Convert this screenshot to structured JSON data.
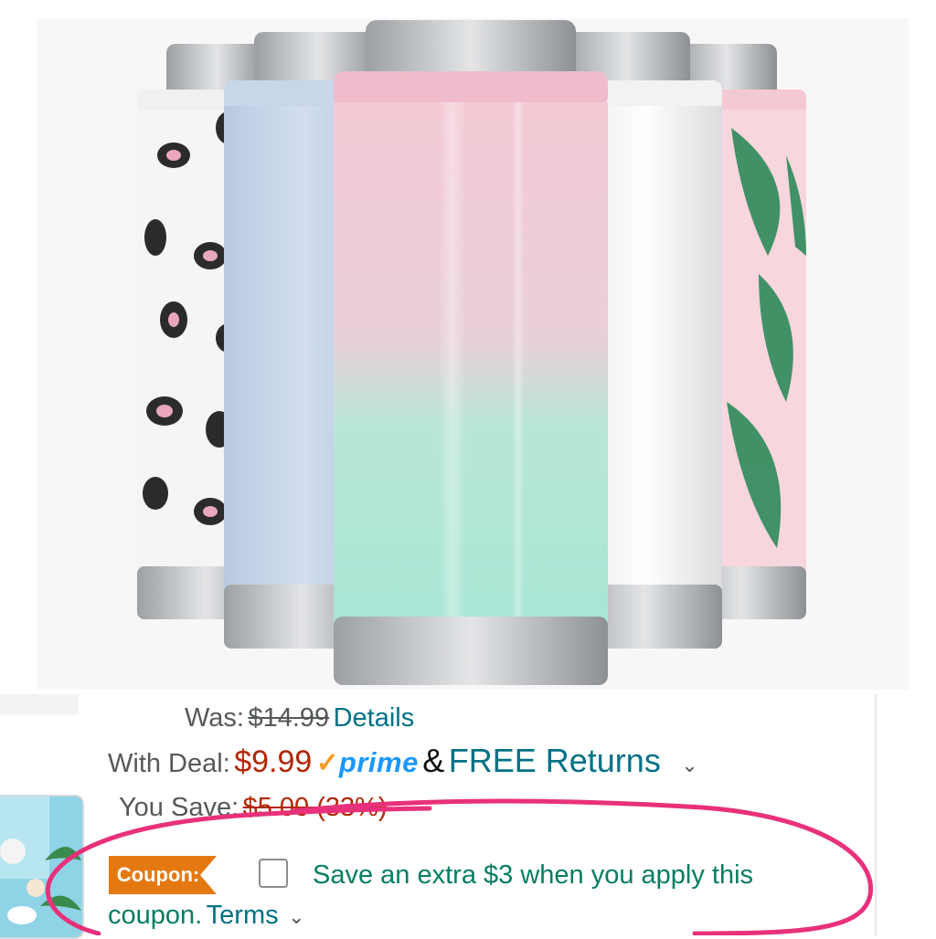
{
  "colors": {
    "price_red": "#b12704",
    "link_teal": "#007185",
    "coupon_green": "#067d62",
    "coupon_badge_orange": "#e47911",
    "prime_blue": "#1a98ff",
    "annotation_pink": "#e8317a"
  },
  "product_image": {
    "alt": "Five slim can cooler tumblers: leopard print, light blue, pink-to-mint iridescent glitter, white, and pink tropical leaf"
  },
  "pricing": {
    "was_label": "Was:",
    "was_price": "$14.99",
    "details_link": "Details",
    "deal_label": "With Deal:",
    "deal_price": "$9.99",
    "prime_check": "✓",
    "prime_text": "prime",
    "ampersand": "&",
    "free_returns": "FREE Returns",
    "free_returns_chevron": "chevron-down-icon",
    "save_label": "You Save:",
    "save_amount": "$5.00 (33%)"
  },
  "coupon": {
    "badge_label": "Coupon:",
    "checkbox_checked": false,
    "text_line1": "Save an extra $3 when you apply this",
    "text_line2": "coupon.",
    "terms_link": "Terms",
    "terms_chevron": "chevron-down-icon"
  }
}
